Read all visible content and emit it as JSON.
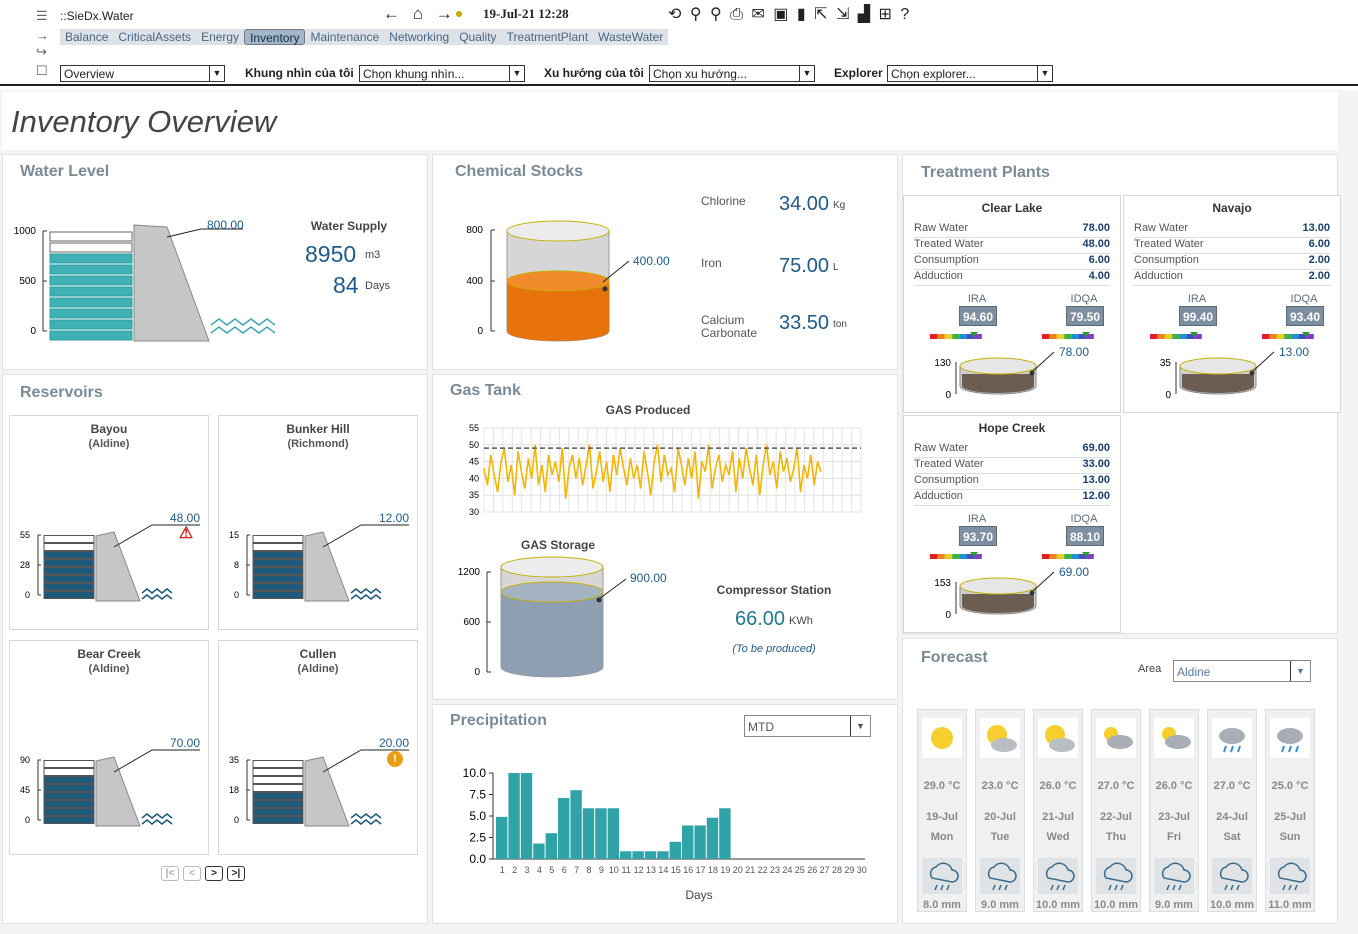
{
  "app": {
    "title": "::SieDx.Water",
    "datetime": "19-Jul-21 12:28",
    "nav_arrows": "← ⌂ →",
    "toolbar_icons": "⟲ ⚲ ⚲ ⎙ ✉ ▣ ▮ ⇱ ⇲ ▟ ⊞ ?"
  },
  "tabs": [
    "Balance",
    "CriticalAssets",
    "Energy",
    "Inventory",
    "Maintenance",
    "Networking",
    "Quality",
    "TreatmentPlant",
    "WasteWater"
  ],
  "selectors": {
    "view_value": "Overview",
    "myview_label": "Khung nhìn của tôi",
    "myview_value": "Chọn khung nhìn...",
    "trend_label": "Xu hướng của tôi",
    "trend_value": "Chọn xu hướng...",
    "explorer_label": "Explorer",
    "explorer_value": "Chọn explorer..."
  },
  "page_title": "Inventory Overview",
  "water_level": {
    "title": "Water Level",
    "ticks": [
      "1000",
      "500",
      "0"
    ],
    "level": "800.00",
    "level_fraction": 0.8,
    "supply_label": "Water Supply",
    "supply_value": "8950",
    "supply_unit": "m3",
    "days_value": "84",
    "days_unit": "Days"
  },
  "chemical_stocks": {
    "title": "Chemical Stocks",
    "ticks": [
      "800",
      "400",
      "0"
    ],
    "level": "400.00",
    "level_fraction": 0.5,
    "items": [
      {
        "name": "Chlorine",
        "value": "34.00",
        "unit": "Kg"
      },
      {
        "name": "Iron",
        "value": "75.00",
        "unit": "L"
      },
      {
        "name": "Calcium Carbonate",
        "value": "33.50",
        "unit": "ton"
      }
    ]
  },
  "treatment_plants": {
    "title": "Treatment Plants",
    "plants": [
      {
        "name": "Clear Lake",
        "rows": [
          [
            "Raw Water",
            "78.00"
          ],
          [
            "Treated Water",
            "48.00"
          ],
          [
            "Consumption",
            "6.00"
          ],
          [
            "Adduction",
            "4.00"
          ]
        ],
        "ira": "94.60",
        "idqa": "79.50",
        "tank_max": "130",
        "tank_min": "0",
        "tank_value": "78.00"
      },
      {
        "name": "Navajo",
        "rows": [
          [
            "Raw Water",
            "13.00"
          ],
          [
            "Treated Water",
            "6.00"
          ],
          [
            "Consumption",
            "2.00"
          ],
          [
            "Adduction",
            "2.00"
          ]
        ],
        "ira": "99.40",
        "idqa": "93.40",
        "tank_max": "35",
        "tank_min": "0",
        "tank_value": "13.00"
      },
      {
        "name": "Hope Creek",
        "rows": [
          [
            "Raw Water",
            "69.00"
          ],
          [
            "Treated Water",
            "33.00"
          ],
          [
            "Consumption",
            "13.00"
          ],
          [
            "Adduction",
            "12.00"
          ]
        ],
        "ira": "93.70",
        "idqa": "88.10",
        "tank_max": "153",
        "tank_min": "0",
        "tank_value": "69.00"
      }
    ],
    "ira_label": "IRA",
    "idqa_label": "IDQA"
  },
  "reservoirs": {
    "title": "Reservoirs",
    "items": [
      {
        "name": "Bayou",
        "area": "(Aldine)",
        "ticks": [
          "55",
          "28",
          "0"
        ],
        "value": "48.00",
        "fill": 0.87,
        "alert": "⚠",
        "alert_color": "#d9211b"
      },
      {
        "name": "Bunker Hill",
        "area": "(Richmond)",
        "ticks": [
          "15",
          "8",
          "0"
        ],
        "value": "12.00",
        "fill": 0.8,
        "alert": "",
        "alert_color": ""
      },
      {
        "name": "Bear Creek",
        "area": "(Aldine)",
        "ticks": [
          "90",
          "45",
          "0"
        ],
        "value": "70.00",
        "fill": 0.78,
        "alert": "",
        "alert_color": ""
      },
      {
        "name": "Cullen",
        "area": "(Aldine)",
        "ticks": [
          "35",
          "18",
          "0"
        ],
        "value": "20.00",
        "fill": 0.57,
        "alert": "!",
        "alert_color": "#e8a010"
      }
    ],
    "pager": [
      "|<",
      "<",
      ">",
      ">|"
    ]
  },
  "gas_tank": {
    "title": "Gas Tank",
    "produced_title": "GAS Produced",
    "produced_ticks": [
      "55",
      "50",
      "45",
      "40",
      "35",
      "30"
    ],
    "storage_title": "GAS Storage",
    "storage_ticks": [
      "1200",
      "600",
      "0"
    ],
    "storage_level": "900.00",
    "storage_fraction": 0.75,
    "compressor_label": "Compressor Station",
    "compressor_value": "66.00",
    "compressor_unit": "KWh",
    "compressor_note": "(To be produced)"
  },
  "precipitation": {
    "title": "Precipitation",
    "period": "MTD",
    "xlabel": "Days"
  },
  "chart_data": [
    {
      "type": "line",
      "title": "GAS Produced",
      "ylim": [
        30,
        55
      ],
      "reference_line": 49,
      "grid": true,
      "series": [
        {
          "values": [
            43,
            38,
            47,
            41,
            36,
            45,
            49,
            39,
            44,
            35,
            48,
            42,
            37,
            46,
            40,
            50,
            38,
            44,
            36,
            47,
            41,
            45,
            39,
            49,
            34,
            43,
            47,
            40,
            46,
            38,
            44,
            50,
            37,
            42,
            48,
            39,
            45,
            36,
            47,
            41,
            49,
            43,
            38,
            46,
            40,
            44,
            37,
            48,
            42,
            35,
            45,
            50,
            39,
            47,
            41,
            43,
            36,
            49,
            44,
            38,
            46,
            40,
            48,
            34,
            45,
            42,
            50,
            37,
            43,
            47,
            39,
            44,
            41,
            48,
            36,
            46,
            40,
            49,
            43,
            38,
            47,
            35,
            44,
            50,
            41,
            45,
            37,
            48,
            42,
            46,
            39,
            43,
            49,
            36,
            44,
            40,
            47,
            38,
            45,
            42
          ]
        }
      ]
    },
    {
      "type": "bar",
      "title": "Precipitation",
      "xlabel": "Days",
      "ylabel": "",
      "ylim": [
        0,
        10
      ],
      "y_ticks": [
        "10.0",
        "7.5",
        "5.0",
        "2.5",
        "0.0"
      ],
      "categories": [
        "1",
        "2",
        "3",
        "4",
        "5",
        "6",
        "7",
        "8",
        "9",
        "10",
        "11",
        "12",
        "13",
        "14",
        "15",
        "16",
        "17",
        "18",
        "19",
        "20",
        "21",
        "22",
        "23",
        "24",
        "25",
        "26",
        "27",
        "28",
        "29",
        "30"
      ],
      "values": [
        4.9,
        10.0,
        10.0,
        1.8,
        3.0,
        7.1,
        8.0,
        5.9,
        5.9,
        5.9,
        0.9,
        0.9,
        0.9,
        0.9,
        2.0,
        3.9,
        3.9,
        4.8,
        5.9,
        0,
        0,
        0,
        0,
        0,
        0,
        0,
        0,
        0,
        0,
        0
      ],
      "color": "#2fa3a8"
    }
  ],
  "forecast": {
    "title": "Forecast",
    "area_label": "Area",
    "area_value": "Aldine",
    "days": [
      {
        "icon": "sun-icon",
        "temp": "29.0 °C",
        "date": "19-Jul",
        "dow": "Mon",
        "rain": "8.0 mm"
      },
      {
        "icon": "sun-cloud-icon",
        "temp": "23.0 °C",
        "date": "20-Jul",
        "dow": "Tue",
        "rain": "9.0 mm"
      },
      {
        "icon": "sun-cloud-icon",
        "temp": "26.0 °C",
        "date": "21-Jul",
        "dow": "Wed",
        "rain": "10.0 mm"
      },
      {
        "icon": "partly-cloudy-icon",
        "temp": "27.0 °C",
        "date": "22-Jul",
        "dow": "Thu",
        "rain": "10.0 mm"
      },
      {
        "icon": "partly-cloudy-icon",
        "temp": "26.0 °C",
        "date": "23-Jul",
        "dow": "Fri",
        "rain": "9.0 mm"
      },
      {
        "icon": "rain-cloud-icon",
        "temp": "27.0 °C",
        "date": "24-Jul",
        "dow": "Sat",
        "rain": "10.0 mm"
      },
      {
        "icon": "rain-cloud-icon",
        "temp": "25.0 °C",
        "date": "25-Jul",
        "dow": "Sun",
        "rain": "11.0 mm"
      }
    ]
  }
}
